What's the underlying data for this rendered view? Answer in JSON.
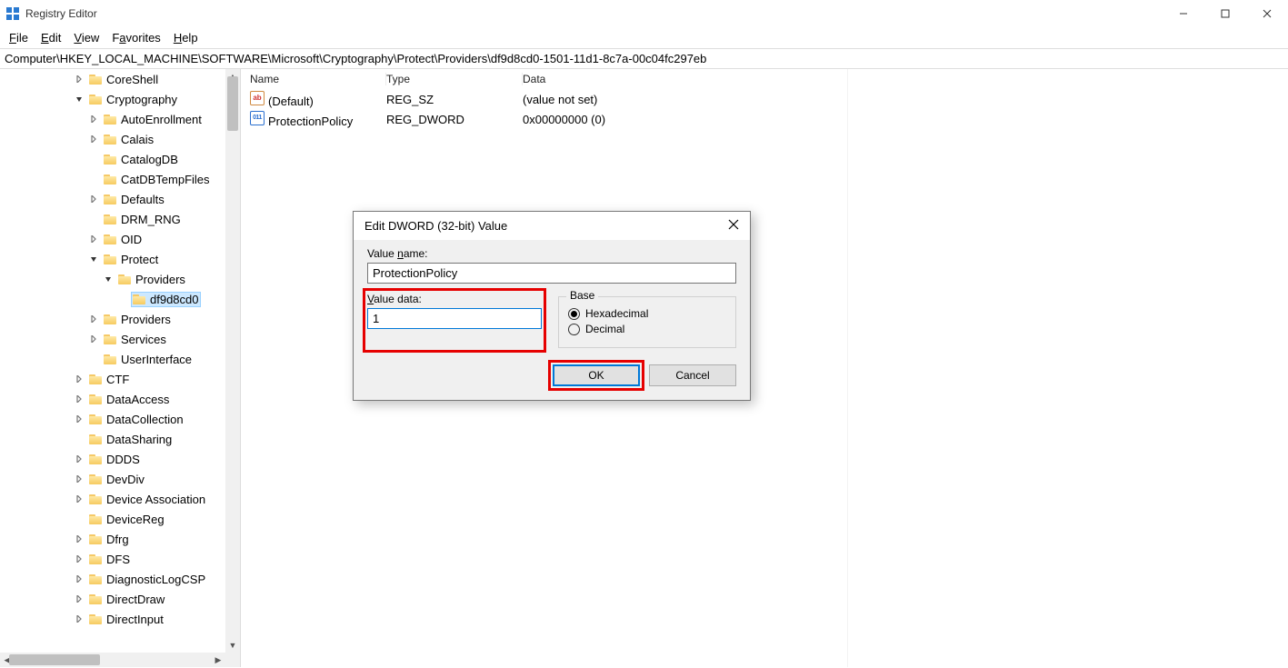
{
  "window": {
    "title": "Registry Editor"
  },
  "menubar": {
    "file": "File",
    "edit": "Edit",
    "view": "View",
    "favorites": "Favorites",
    "help": "Help"
  },
  "addressbar": "Computer\\HKEY_LOCAL_MACHINE\\SOFTWARE\\Microsoft\\Cryptography\\Protect\\Providers\\df9d8cd0-1501-11d1-8c7a-00c04fc297eb",
  "tree": [
    {
      "indent": 5,
      "expander": ">",
      "label": "CoreShell",
      "selected": false
    },
    {
      "indent": 5,
      "expander": "v",
      "label": "Cryptography",
      "selected": false
    },
    {
      "indent": 6,
      "expander": ">",
      "label": "AutoEnrollment",
      "selected": false
    },
    {
      "indent": 6,
      "expander": ">",
      "label": "Calais",
      "selected": false
    },
    {
      "indent": 6,
      "expander": "",
      "label": "CatalogDB",
      "selected": false
    },
    {
      "indent": 6,
      "expander": "",
      "label": "CatDBTempFiles",
      "selected": false
    },
    {
      "indent": 6,
      "expander": ">",
      "label": "Defaults",
      "selected": false
    },
    {
      "indent": 6,
      "expander": "",
      "label": "DRM_RNG",
      "selected": false
    },
    {
      "indent": 6,
      "expander": ">",
      "label": "OID",
      "selected": false
    },
    {
      "indent": 6,
      "expander": "v",
      "label": "Protect",
      "selected": false
    },
    {
      "indent": 7,
      "expander": "v",
      "label": "Providers",
      "selected": false
    },
    {
      "indent": 8,
      "expander": "",
      "label": "df9d8cd0",
      "selected": true
    },
    {
      "indent": 6,
      "expander": ">",
      "label": "Providers",
      "selected": false
    },
    {
      "indent": 6,
      "expander": ">",
      "label": "Services",
      "selected": false
    },
    {
      "indent": 6,
      "expander": "",
      "label": "UserInterface",
      "selected": false
    },
    {
      "indent": 5,
      "expander": ">",
      "label": "CTF",
      "selected": false
    },
    {
      "indent": 5,
      "expander": ">",
      "label": "DataAccess",
      "selected": false
    },
    {
      "indent": 5,
      "expander": ">",
      "label": "DataCollection",
      "selected": false
    },
    {
      "indent": 5,
      "expander": "",
      "label": "DataSharing",
      "selected": false
    },
    {
      "indent": 5,
      "expander": ">",
      "label": "DDDS",
      "selected": false
    },
    {
      "indent": 5,
      "expander": ">",
      "label": "DevDiv",
      "selected": false
    },
    {
      "indent": 5,
      "expander": ">",
      "label": "Device Association",
      "selected": false
    },
    {
      "indent": 5,
      "expander": "",
      "label": "DeviceReg",
      "selected": false
    },
    {
      "indent": 5,
      "expander": ">",
      "label": "Dfrg",
      "selected": false
    },
    {
      "indent": 5,
      "expander": ">",
      "label": "DFS",
      "selected": false
    },
    {
      "indent": 5,
      "expander": ">",
      "label": "DiagnosticLogCSP",
      "selected": false
    },
    {
      "indent": 5,
      "expander": ">",
      "label": "DirectDraw",
      "selected": false
    },
    {
      "indent": 5,
      "expander": ">",
      "label": "DirectInput",
      "selected": false
    }
  ],
  "list": {
    "headers": {
      "name": "Name",
      "type": "Type",
      "data": "Data"
    },
    "rows": [
      {
        "icon": "str",
        "name": "(Default)",
        "type": "REG_SZ",
        "data": "(value not set)"
      },
      {
        "icon": "dword",
        "name": "ProtectionPolicy",
        "type": "REG_DWORD",
        "data": "0x00000000 (0)"
      }
    ]
  },
  "dialog": {
    "title": "Edit DWORD (32-bit) Value",
    "value_name_label": "Value name:",
    "value_name": "ProtectionPolicy",
    "value_data_label": "Value data:",
    "value_data": "1",
    "base_label": "Base",
    "hex_label": "Hexadecimal",
    "dec_label": "Decimal",
    "base_selected": "hex",
    "ok": "OK",
    "cancel": "Cancel"
  }
}
